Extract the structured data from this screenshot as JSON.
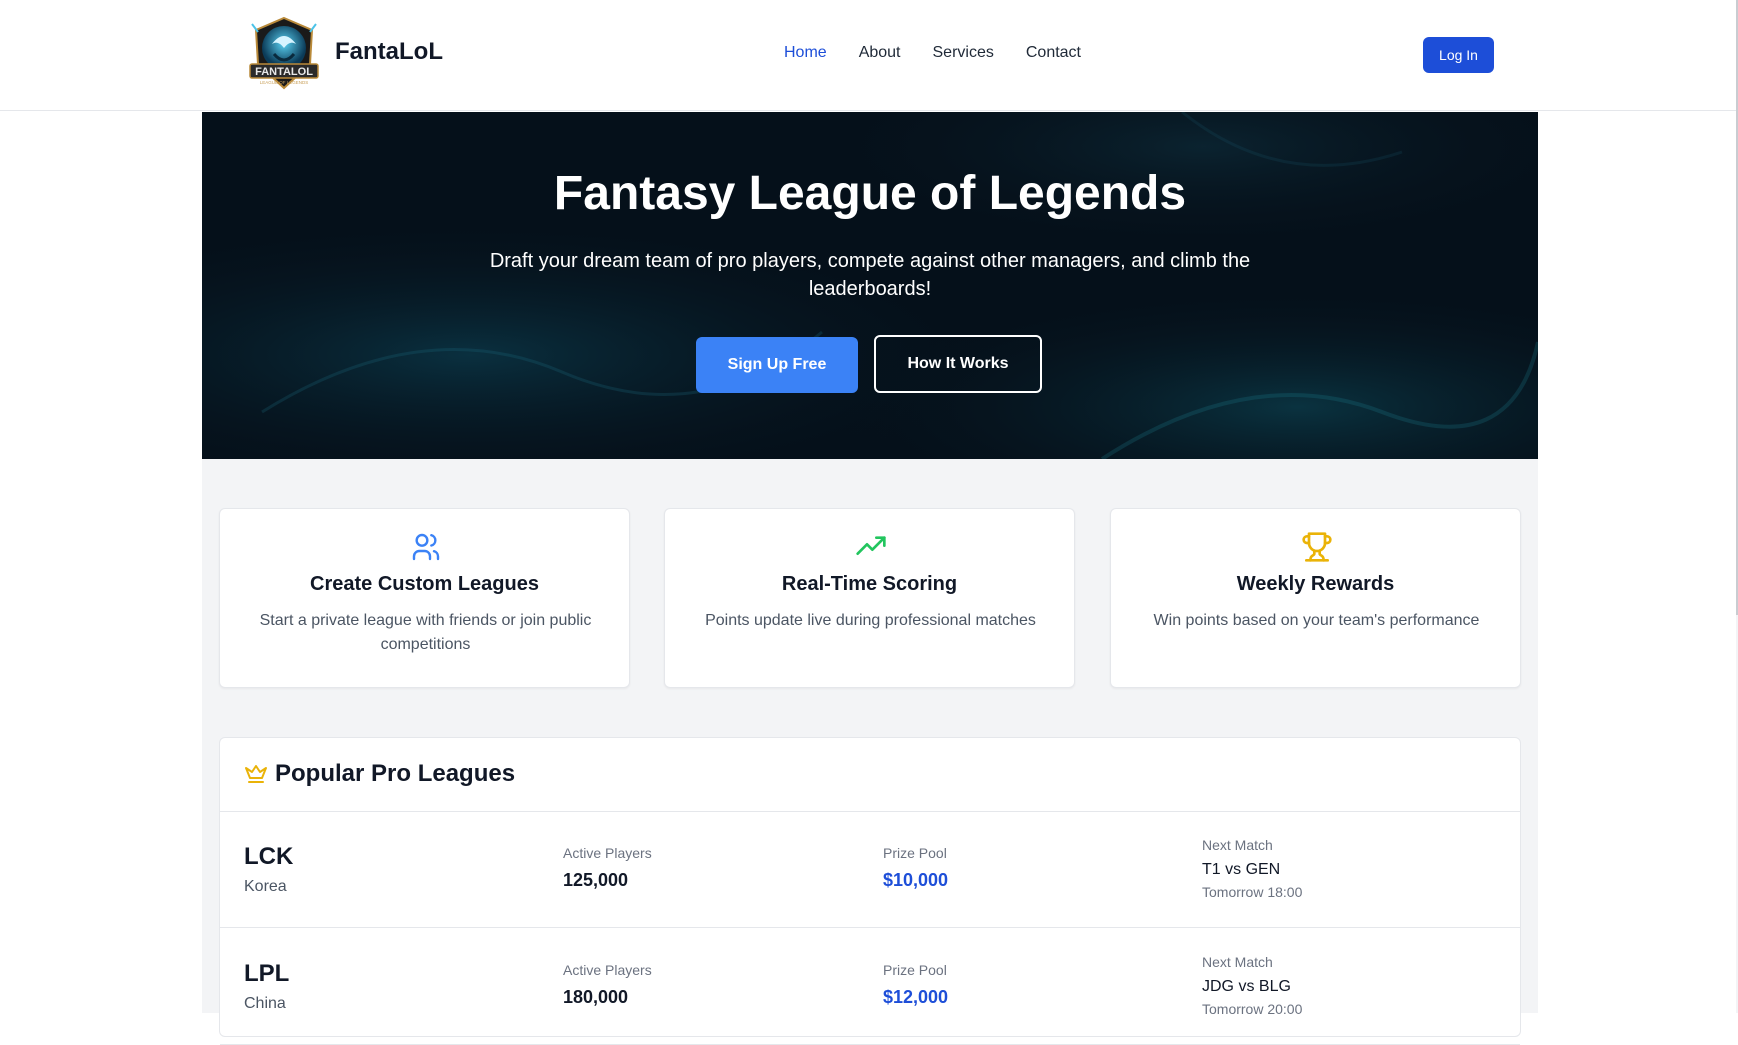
{
  "header": {
    "brand": "FantaLoL",
    "logo_text": "FANTALOL",
    "logo_subtext": "LEAGUE OF LEGENDS",
    "nav": [
      {
        "label": "Home",
        "active": true
      },
      {
        "label": "About",
        "active": false
      },
      {
        "label": "Services",
        "active": false
      },
      {
        "label": "Contact",
        "active": false
      }
    ],
    "login_label": "Log In"
  },
  "hero": {
    "title": "Fantasy League of Legends",
    "subtitle": "Draft your dream team of pro players, compete against other managers, and climb the leaderboards!",
    "primary_cta": "Sign Up Free",
    "secondary_cta": "How It Works"
  },
  "features": [
    {
      "icon": "users-icon",
      "title": "Create Custom Leagues",
      "description": "Start a private league with friends or join public competitions",
      "color": "#3b82f6"
    },
    {
      "icon": "trending-up-icon",
      "title": "Real-Time Scoring",
      "description": "Points update live during professional matches",
      "color": "#22c55e"
    },
    {
      "icon": "trophy-icon",
      "title": "Weekly Rewards",
      "description": "Win points based on your team's performance",
      "color": "#eab308"
    }
  ],
  "popular_leagues": {
    "title": "Popular Pro Leagues",
    "icon": "crown-icon",
    "labels": {
      "players": "Active Players",
      "prize": "Prize Pool",
      "next_match": "Next Match"
    },
    "rows": [
      {
        "code": "LCK",
        "region": "Korea",
        "players": "125,000",
        "prize": "$10,000",
        "match": "T1 vs GEN",
        "match_time": "Tomorrow 18:00"
      },
      {
        "code": "LPL",
        "region": "China",
        "players": "180,000",
        "prize": "$12,000",
        "match": "JDG vs BLG",
        "match_time": "Tomorrow 20:00"
      }
    ]
  },
  "colors": {
    "accent": "#1d4ed8",
    "primary_button": "#3b82f6",
    "hero_bg": "#06121b",
    "page_bg": "#f3f4f6"
  }
}
